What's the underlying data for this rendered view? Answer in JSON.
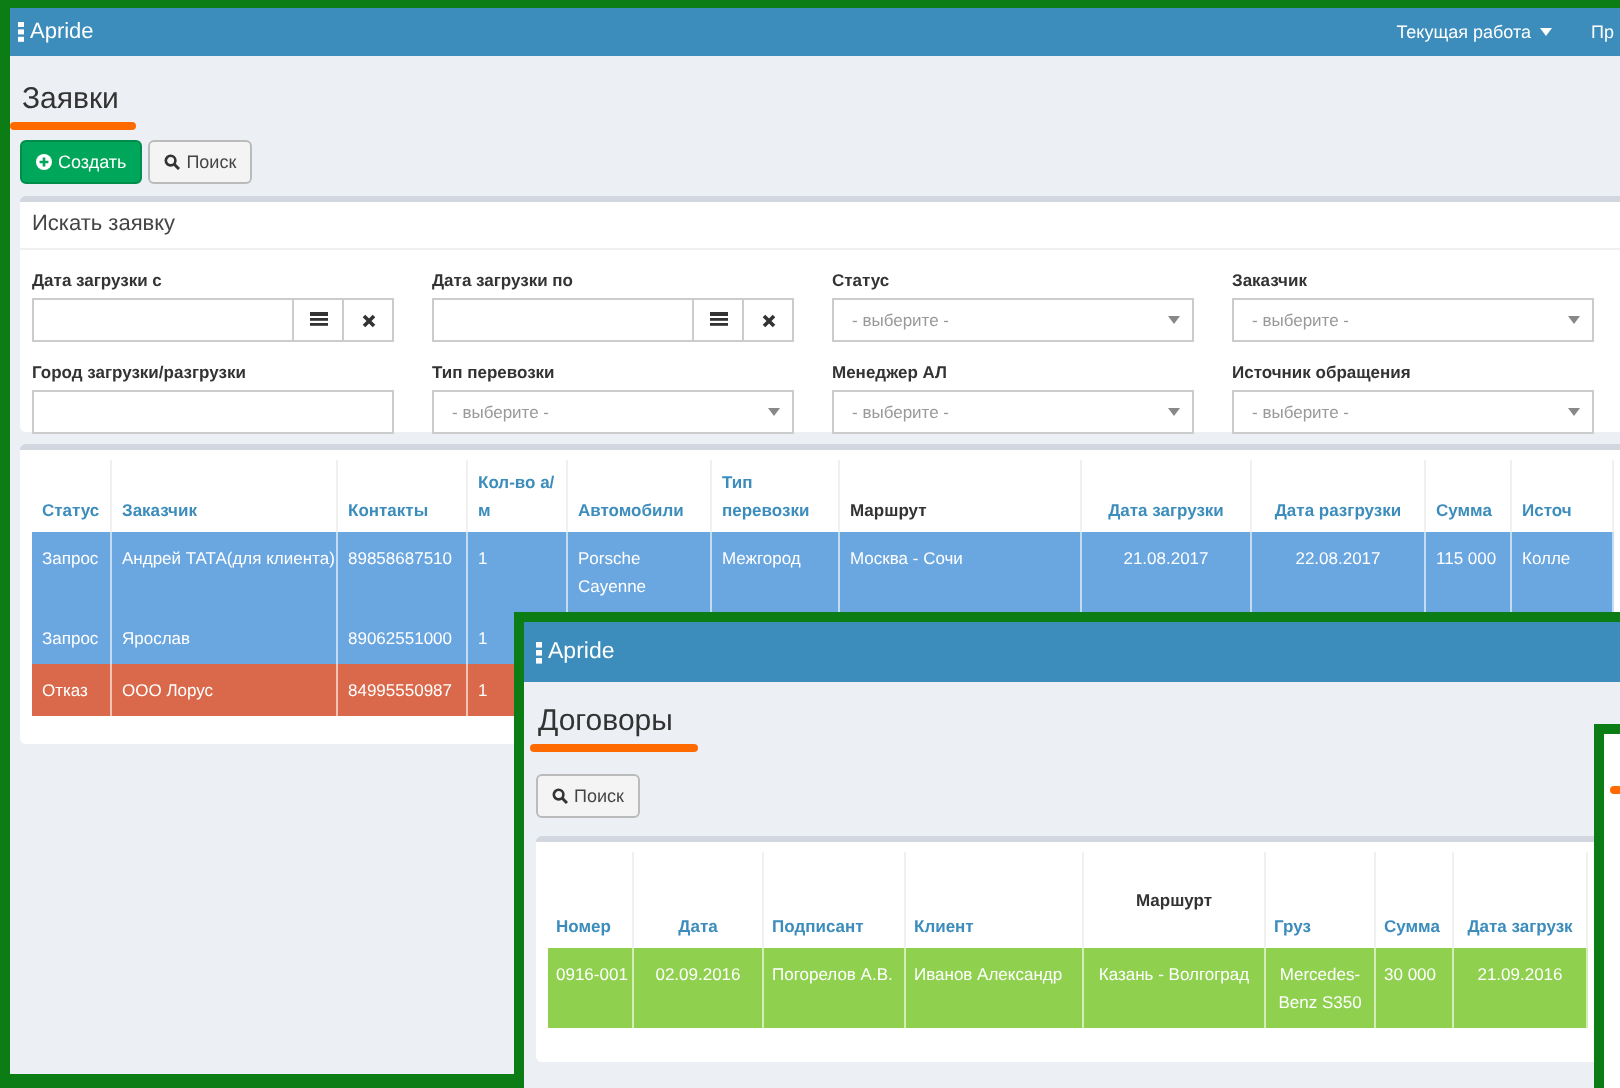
{
  "top_window": {
    "brand": "Apride",
    "nav": [
      {
        "label": "Текущая работа",
        "dropdown": true
      },
      {
        "label": "Пр",
        "dropdown": false
      }
    ],
    "title": "Заявки",
    "buttons": [
      {
        "kind": "primary",
        "label": "Создать"
      },
      {
        "kind": "default",
        "label": "Поиск"
      }
    ],
    "search_panel": {
      "title": "Искать заявку",
      "fields": [
        {
          "label": "Дата загрузки с",
          "kind": "date"
        },
        {
          "label": "Дата загрузки по",
          "kind": "date"
        },
        {
          "label": "Статус",
          "kind": "select",
          "placeholder": "- выберите -"
        },
        {
          "label": "Заказчик",
          "kind": "select",
          "placeholder": "- выберите -"
        },
        {
          "label": "Город загрузки/разгрузки",
          "kind": "text"
        },
        {
          "label": "Тип перевозки",
          "kind": "select",
          "placeholder": "- выберите -"
        },
        {
          "label": "Менеджер АЛ",
          "kind": "select",
          "placeholder": "- выберите -"
        },
        {
          "label": "Источник обращения",
          "kind": "select",
          "placeholder": "- выберите -"
        }
      ]
    },
    "table": {
      "columns": [
        {
          "label": "Статус",
          "sortable": true
        },
        {
          "label": "Заказчик",
          "sortable": true
        },
        {
          "label": "Контакты",
          "sortable": true
        },
        {
          "label": "Кол-во а/м",
          "sortable": true
        },
        {
          "label": "Автомобили",
          "sortable": true
        },
        {
          "label": "Тип перевозки",
          "sortable": true
        },
        {
          "label": "Маршрут",
          "sortable": false
        },
        {
          "label": "Дата загрузки",
          "sortable": true
        },
        {
          "label": "Дата разгрузки",
          "sortable": true
        },
        {
          "label": "Сумма",
          "sortable": true
        },
        {
          "label": "Источ",
          "sortable": true
        }
      ],
      "rows": [
        {
          "color": "#6aa6e0",
          "cells": [
            "Запрос",
            "Андрей ТАТА(для клиента)",
            "89858687510",
            "1",
            "Porsche Cayenne",
            "Межгород",
            "Москва - Сочи",
            "21.08.2017",
            "22.08.2017",
            "115 000",
            "Колле"
          ]
        },
        {
          "color": "#6aa6e0",
          "cells": [
            "Запрос",
            "Ярослав",
            "89062551000",
            "1"
          ]
        },
        {
          "color": "#d9694a",
          "cells": [
            "Отказ",
            "ООО Лорус",
            "84995550987",
            "1"
          ]
        }
      ]
    }
  },
  "overlay_window": {
    "brand": "Apride",
    "title": "Договоры",
    "buttons": [
      {
        "kind": "default",
        "label": "Поиск"
      }
    ],
    "table": {
      "columns": [
        {
          "label": "Номер",
          "sortable": true
        },
        {
          "label": "Дата",
          "sortable": true
        },
        {
          "label": "Подписант",
          "sortable": true
        },
        {
          "label": "Клиент",
          "sortable": true
        },
        {
          "label": "Маршурт",
          "sortable": false
        },
        {
          "label": "Груз",
          "sortable": true
        },
        {
          "label": "Сумма",
          "sortable": true
        },
        {
          "label": "Дата загрузк",
          "sortable": true
        }
      ],
      "rows": [
        {
          "color": "#8fd14f",
          "cells": [
            "0916-001",
            "02.09.2016",
            "Погорелов А.В.",
            "Иванов Александр",
            "Казань - Волгоград",
            "Mercedes-Benz S350",
            "30 000",
            "21.09.2016"
          ]
        }
      ]
    }
  }
}
